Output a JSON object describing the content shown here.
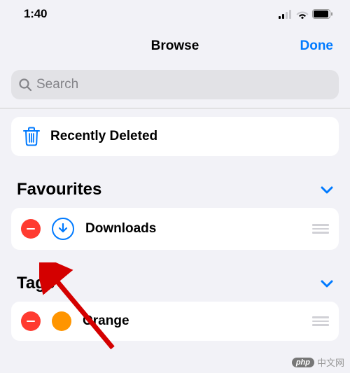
{
  "status": {
    "time": "1:40"
  },
  "nav": {
    "title": "Browse",
    "done": "Done"
  },
  "search": {
    "placeholder": "Search"
  },
  "locations": {
    "recently_deleted": "Recently Deleted"
  },
  "sections": {
    "favourites": {
      "title": "Favourites",
      "items": [
        {
          "label": "Downloads"
        }
      ]
    },
    "tags": {
      "title": "Tags",
      "items": [
        {
          "label": "Orange",
          "color": "#ff9500"
        }
      ]
    }
  },
  "watermark": {
    "badge": "php",
    "text": "中文网"
  }
}
